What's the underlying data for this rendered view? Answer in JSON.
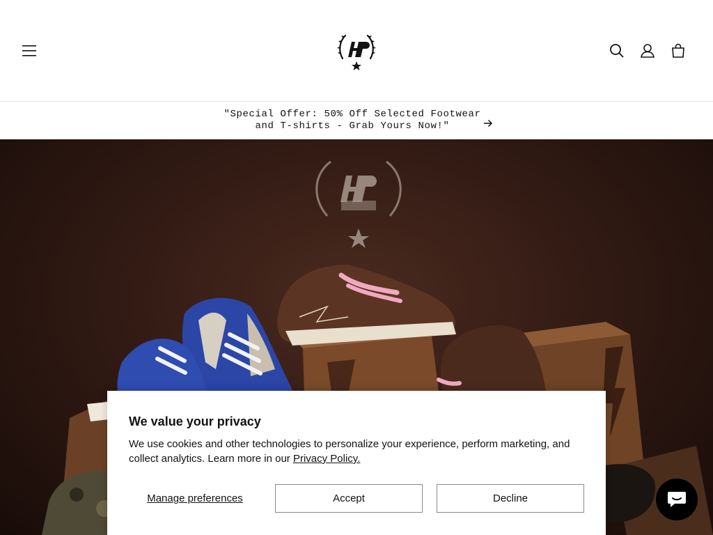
{
  "header": {
    "menu_icon": "hamburger-icon",
    "logo_icon": "hp-star-wreath-logo",
    "search_icon": "search-icon",
    "account_icon": "account-icon",
    "cart_icon": "cart-icon"
  },
  "announcement": {
    "text": "\"Special Offer: 50% Off Selected Footwear and T-shirts - Grab Yours Now!\"",
    "arrow_icon": "arrow-right-icon"
  },
  "consent": {
    "title": "We value your privacy",
    "body": "We use cookies and other technologies to personalize your experience, perform marketing, and collect analytics. Learn more in our ",
    "policy_link": "Privacy Policy.",
    "manage_label": "Manage preferences",
    "accept_label": "Accept",
    "decline_label": "Decline"
  },
  "chat": {
    "icon": "chat-bubble-icon"
  },
  "colors": {
    "accent": "#121212",
    "hero_bg": "#2e1812",
    "chat_bg": "#000000"
  }
}
